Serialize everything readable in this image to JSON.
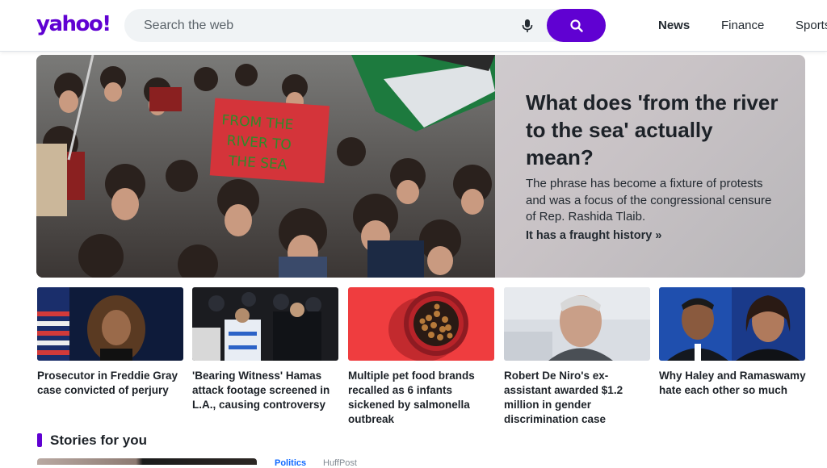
{
  "header": {
    "logo": "yahoo!",
    "search_placeholder": "Search the web",
    "nav": [
      "News",
      "Finance",
      "Sports"
    ],
    "active_nav": "News"
  },
  "hero": {
    "title": "What does 'from the river to the sea' actually mean?",
    "description": "The phrase has become a fixture of protests and was a focus of the congressional censure of Rep. Rashida Tlaib.",
    "link": "It has a fraught history »",
    "sign_text": [
      "FROM THE",
      "RIVER TO",
      "THE SEA"
    ]
  },
  "cards": [
    {
      "title": "Prosecutor in Freddie Gray case convicted of perjury"
    },
    {
      "title": "'Bearing Witness' Hamas attack footage screened in L.A., causing controversy"
    },
    {
      "title": "Multiple pet food brands recalled as 6 infants sickened by salmonella outbreak"
    },
    {
      "title": "Robert De Niro's ex-assistant awarded $1.2 million in gender discrimination case"
    },
    {
      "title": "Why Haley and Ramaswamy hate each other so much"
    }
  ],
  "stories": {
    "title": "Stories for you",
    "category": "Politics",
    "source": "HuffPost"
  },
  "colors": {
    "brand": "#6001d2",
    "text": "#1d2228",
    "search_bg": "#f0f3f5"
  }
}
